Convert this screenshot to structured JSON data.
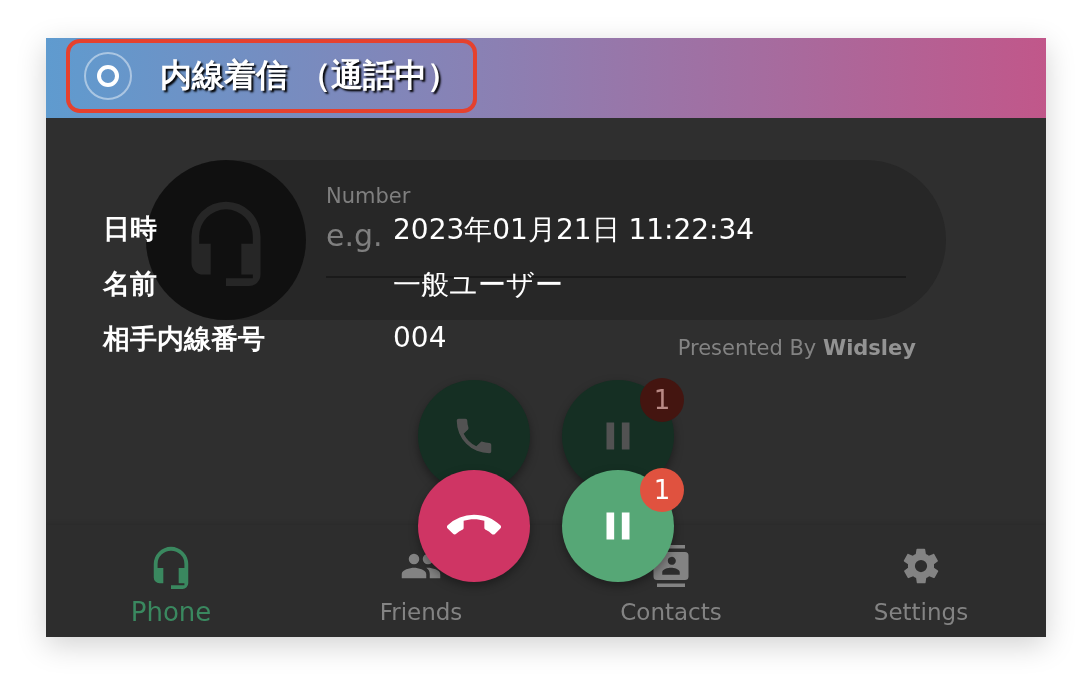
{
  "window": {
    "title": "内線着信 （通話中）"
  },
  "dialer": {
    "number_field": {
      "label": "Number",
      "placeholder": "e.g."
    },
    "credit": "Presented By **Widsley**",
    "buttons": [
      {
        "kind": "call"
      },
      {
        "kind": "hold",
        "badge": "1"
      }
    ]
  },
  "nav": [
    {
      "kind": "phone",
      "label": "Phone",
      "selected": true
    },
    {
      "kind": "friends",
      "label": "Friends",
      "selected": false
    },
    {
      "kind": "contacts",
      "label": "Contacts",
      "selected": false
    },
    {
      "kind": "settings",
      "label": "Settings",
      "selected": false
    }
  ],
  "call_info": [
    {
      "label": "日時",
      "value": "2023年01月21日 11:22:34"
    },
    {
      "label": "名前",
      "value": "一般ユーザー"
    },
    {
      "label": "相手内線番号",
      "value": "004"
    }
  ],
  "call_controls": [
    {
      "kind": "hangup"
    },
    {
      "kind": "hold",
      "badge": "1"
    }
  ]
}
